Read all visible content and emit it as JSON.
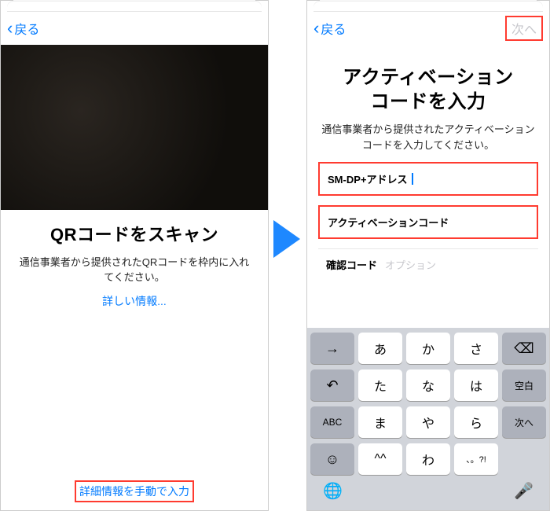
{
  "left": {
    "back": "戻る",
    "title": "QRコードをスキャン",
    "subtitle": "通信事業者から提供されたQRコードを枠内に入れてください。",
    "more_info": "詳しい情報...",
    "manual_link": "詳細情報を手動で入力"
  },
  "right": {
    "back": "戻る",
    "next": "次へ",
    "title_line1": "アクティベーション",
    "title_line2": "コードを入力",
    "subtitle": "通信事業者から提供されたアクティベーションコードを入力してください。",
    "field1_label": "SM-DP+アドレス",
    "field2_label": "アクティベーションコード",
    "field3_label": "確認コード",
    "field3_hint": "オプション"
  },
  "keyboard": {
    "rows": [
      [
        "→",
        "あ",
        "か",
        "さ",
        "⌫"
      ],
      [
        "↶",
        "た",
        "な",
        "は",
        "空白"
      ],
      [
        "ABC",
        "ま",
        "や",
        "ら",
        "次へ"
      ],
      [
        "☺",
        "^^",
        "わ",
        "、。?!",
        ""
      ]
    ],
    "toolbar_globe": "🌐",
    "toolbar_mic": "🎤"
  }
}
